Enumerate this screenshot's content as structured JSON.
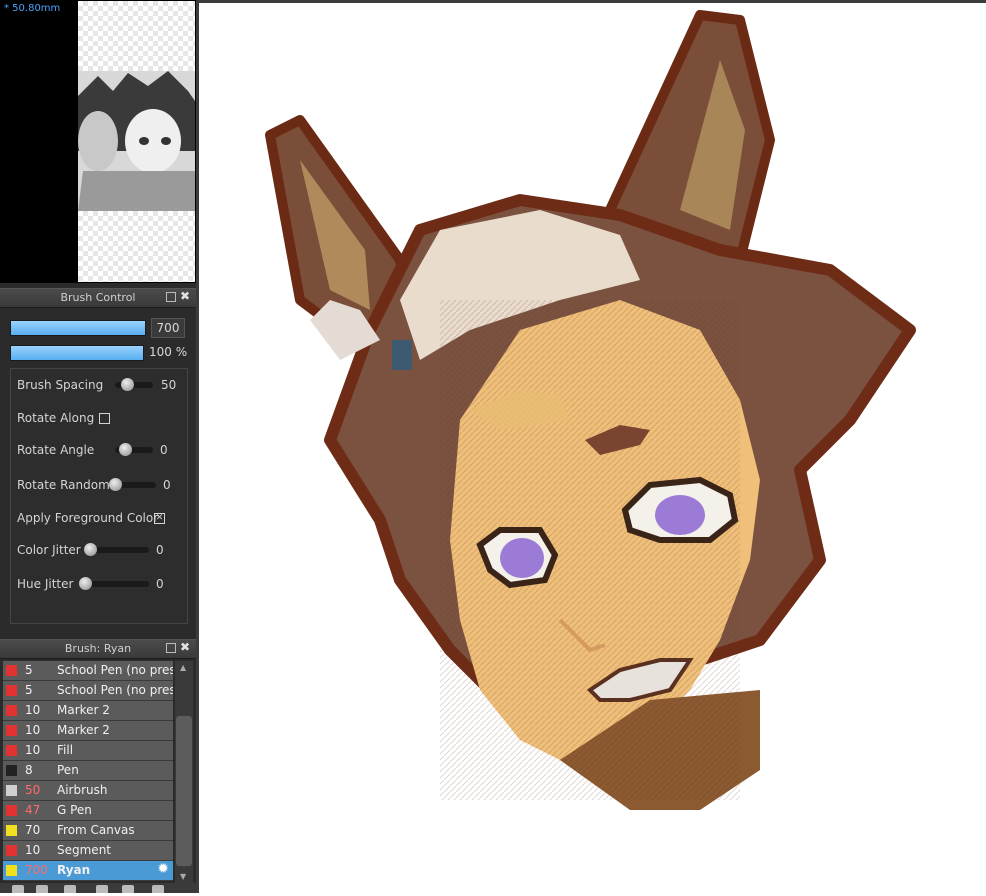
{
  "navigator": {
    "zoom_label": "* 50.80mm"
  },
  "brush_control": {
    "title": "Brush Control",
    "size_value": "700",
    "opacity_value": "100 %",
    "settings": {
      "spacing": {
        "label": "Brush Spacing",
        "value": "50",
        "level": 0.5
      },
      "rotate_along": {
        "label": "Rotate Along",
        "checked": false
      },
      "rotate_angle": {
        "label": "Rotate Angle",
        "value": "0",
        "level": 0.5
      },
      "rotate_random": {
        "label": "Rotate Random",
        "value": "0",
        "level": 0.0
      },
      "apply_fg": {
        "label": "Apply Foreground Color",
        "checked": true,
        "mark": "✕"
      },
      "color_jitter": {
        "label": "Color Jitter",
        "value": "0",
        "level": 0.0
      },
      "hue_jitter": {
        "label": "Hue Jitter",
        "value": "0",
        "level": 0.0
      }
    }
  },
  "brush_panel": {
    "title": "Brush: Ryan",
    "items": [
      {
        "size": "5",
        "name": "School Pen (no pressure)",
        "color": "#e23232",
        "size_color": "#f0f0f0"
      },
      {
        "size": "5",
        "name": "School Pen (no pressure)",
        "color": "#e23232",
        "size_color": "#f0f0f0"
      },
      {
        "size": "10",
        "name": "Marker 2",
        "color": "#e23232",
        "size_color": "#f0f0f0"
      },
      {
        "size": "10",
        "name": "Marker 2",
        "color": "#e23232",
        "size_color": "#f0f0f0"
      },
      {
        "size": "10",
        "name": "Fill",
        "color": "#e23232",
        "size_color": "#f0f0f0"
      },
      {
        "size": "8",
        "name": "Pen",
        "color": "#222222",
        "size_color": "#f0f0f0"
      },
      {
        "size": "50",
        "name": "Airbrush",
        "color": "#cfcfcf",
        "size_color": "#ff6b6b"
      },
      {
        "size": "47",
        "name": "G Pen",
        "color": "#e23232",
        "size_color": "#ff6b6b"
      },
      {
        "size": "70",
        "name": "From Canvas",
        "color": "#f0e020",
        "size_color": "#f0f0f0"
      },
      {
        "size": "10",
        "name": "Segment",
        "color": "#e23232",
        "size_color": "#f0f0f0"
      },
      {
        "size": "700",
        "name": "Ryan",
        "color": "#f0e020",
        "size_color": "#ff6b6b"
      }
    ]
  },
  "icons": [
    "popout-icon",
    "close-icon",
    "gear-icon",
    "scroll-up-icon",
    "scroll-down-icon"
  ]
}
